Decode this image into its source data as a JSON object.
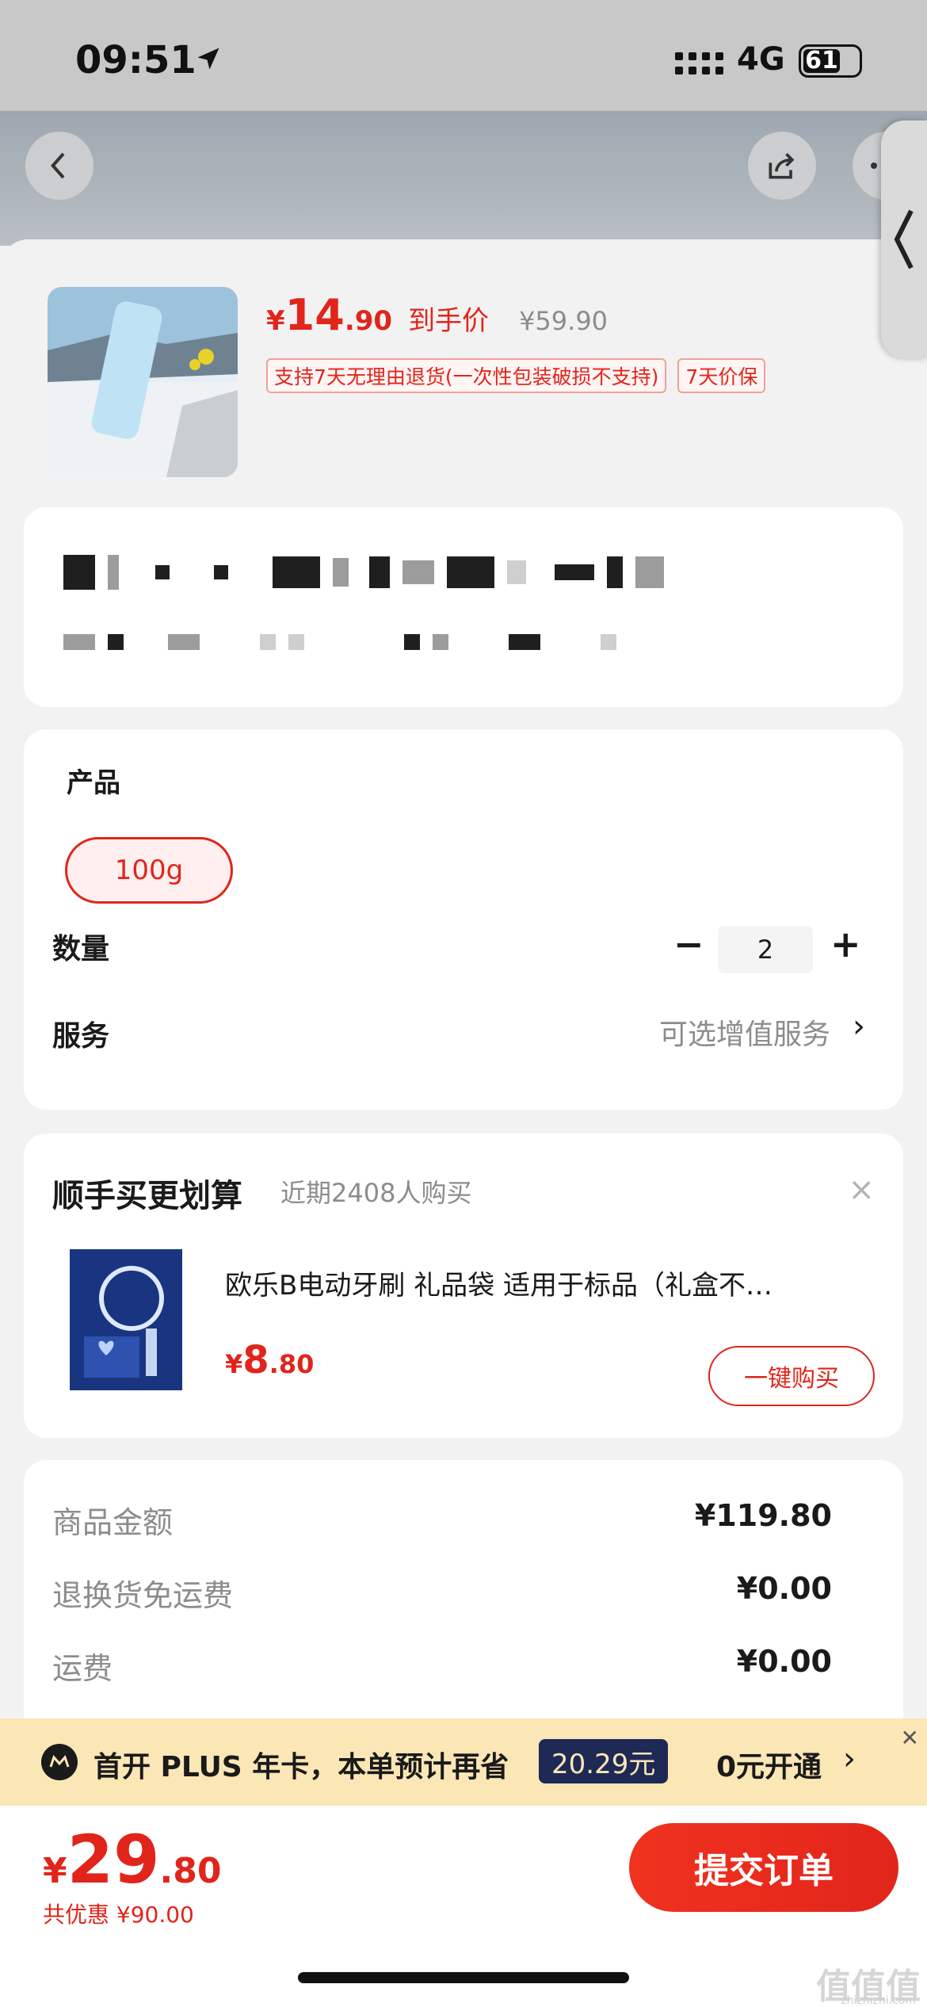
{
  "status_bar": {
    "time": "09:51",
    "network": "4G",
    "battery": "61"
  },
  "product": {
    "currency": "¥",
    "price_int": "14",
    "price_dec": ".90",
    "price_label": "到手价",
    "original_price": "¥59.90",
    "tags": [
      "支持7天无理由退货(一次性包装破损不支持)",
      "7天价保"
    ]
  },
  "spec": {
    "product_label": "产品",
    "option": "100g",
    "quantity_label": "数量",
    "quantity": "2",
    "service_label": "服务",
    "service_value": "可选增值服务"
  },
  "recommend": {
    "title": "顺手买更划算",
    "subtitle": "近期2408人购买",
    "item_name": "欧乐B电动牙刷 礼品袋 适用于标品（礼盒不…",
    "currency": "¥",
    "price_int": "8",
    "price_dec": ".80",
    "buy_label": "一键购买"
  },
  "summary": {
    "rows": [
      {
        "label": "商品金额",
        "value": "¥119.80"
      },
      {
        "label": "退换货免运费",
        "value": "¥0.00"
      },
      {
        "label": "运费",
        "value": "¥0.00"
      }
    ]
  },
  "plus": {
    "text": "首开 PLUS 年卡，本单预计再省",
    "save": "20.29元",
    "open": "0元开通"
  },
  "bottom": {
    "currency": "¥",
    "price_int": "29",
    "price_dec": ".80",
    "discount": "共优惠 ¥90.00",
    "submit": "提交订单"
  },
  "watermark": {
    "logo": "值值值",
    "domain": "zhizhizhi.com"
  },
  "colors": {
    "accent": "#e1251b",
    "plus_bg": "#fbe6b6",
    "plus_badge": "#1e2a55"
  }
}
